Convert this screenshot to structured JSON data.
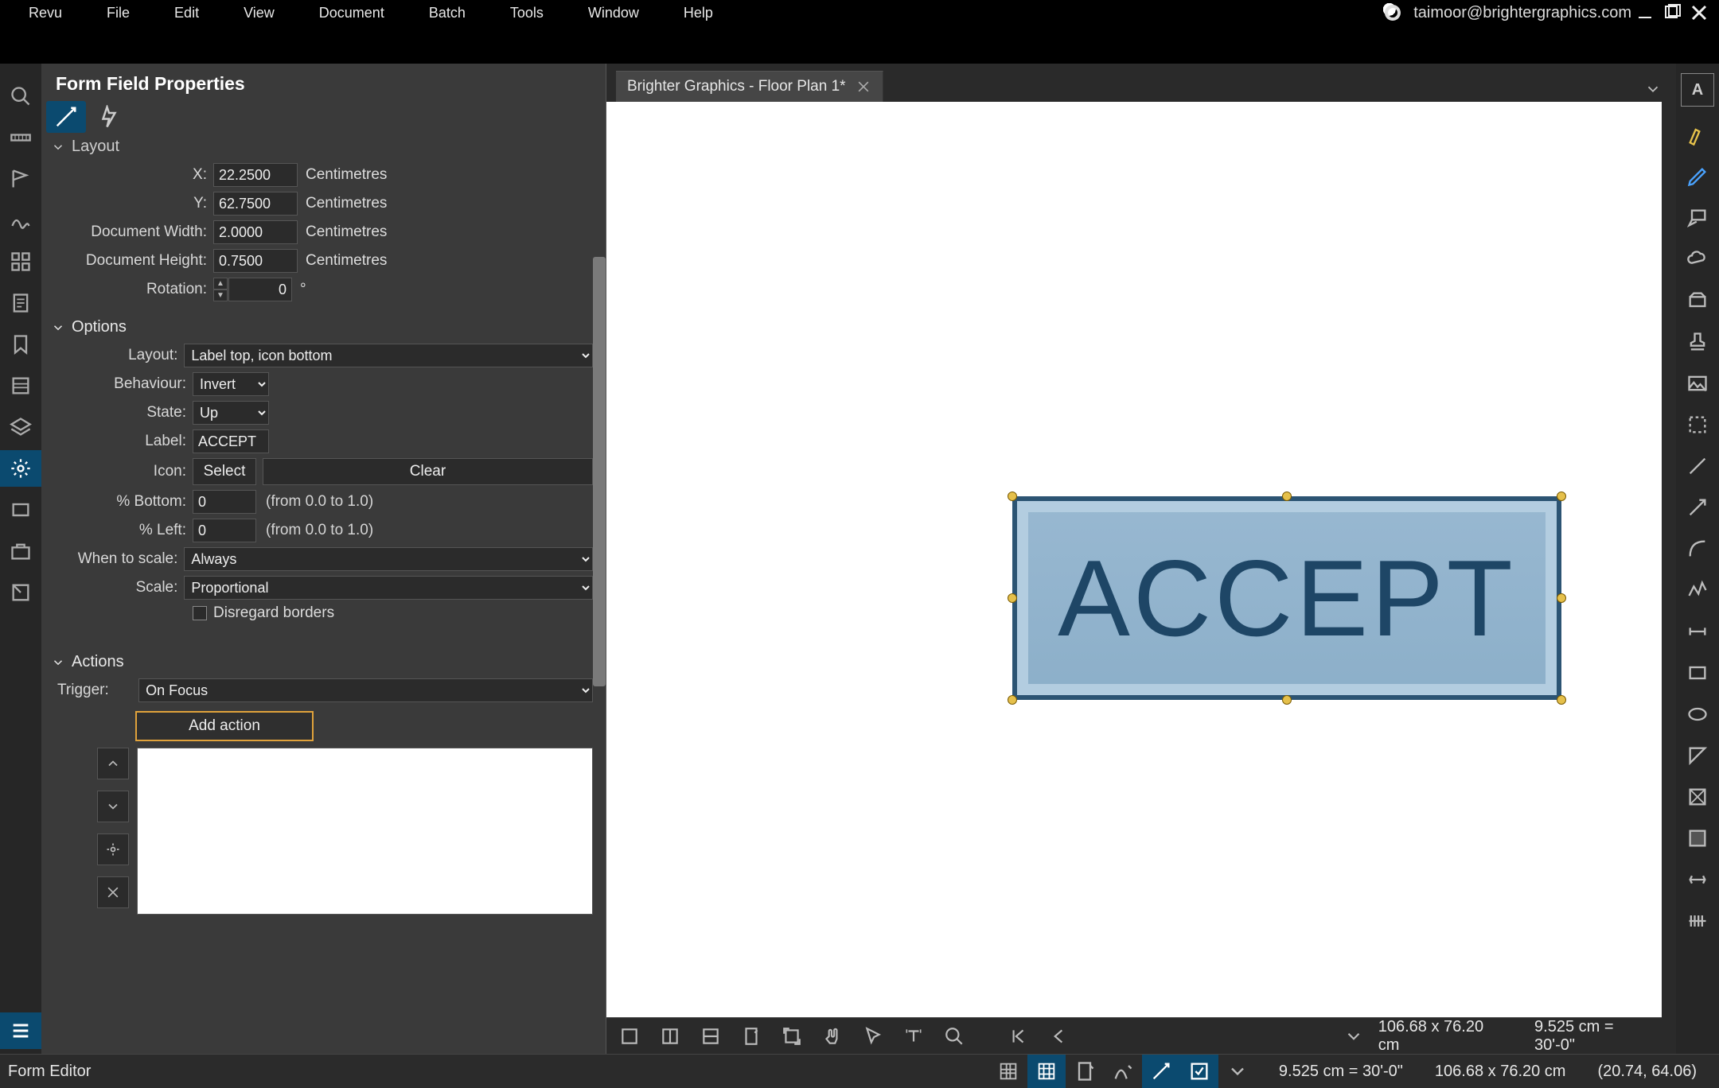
{
  "menu": [
    "Revu",
    "File",
    "Edit",
    "View",
    "Document",
    "Batch",
    "Tools",
    "Window",
    "Help"
  ],
  "user_email": "taimoor@brightergraphics.com",
  "panel_title": "Form Field Properties",
  "sections": {
    "layout": "Layout",
    "options": "Options",
    "actions": "Actions"
  },
  "layout": {
    "x_lbl": "X:",
    "x": "22.2500",
    "y_lbl": "Y:",
    "y": "62.7500",
    "dw_lbl": "Document Width:",
    "dw": "2.0000",
    "dh_lbl": "Document Height:",
    "dh": "0.7500",
    "rot_lbl": "Rotation:",
    "rot": "0",
    "unit": "Centimetres",
    "deg": "°"
  },
  "options": {
    "layout_lbl": "Layout:",
    "layout_val": "Label top, icon bottom",
    "behaviour_lbl": "Behaviour:",
    "behaviour_val": "Invert",
    "state_lbl": "State:",
    "state_val": "Up",
    "label_lbl": "Label:",
    "label_val": "ACCEPT",
    "icon_lbl": "Icon:",
    "select_btn": "Select",
    "clear_btn": "Clear",
    "pct_bottom_lbl": "% Bottom:",
    "pct_bottom_val": "0",
    "pct_left_lbl": "% Left:",
    "pct_left_val": "0",
    "range_hint": "(from 0.0 to 1.0)",
    "when_lbl": "When to scale:",
    "when_val": "Always",
    "scale_lbl": "Scale:",
    "scale_val": "Proportional",
    "disregard": "Disregard borders"
  },
  "actions": {
    "trigger_lbl": "Trigger:",
    "trigger_val": "On Focus",
    "add_action": "Add action"
  },
  "document_tab": "Brighter Graphics - Floor Plan 1*",
  "button_text": "ACCEPT",
  "canvas_status": {
    "size": "106.68 x 76.20 cm",
    "scale": "9.525 cm = 30'-0\""
  },
  "statusbar": {
    "mode": "Form Editor",
    "scale": "9.525 cm = 30'-0\"",
    "size": "106.68 x 76.20 cm",
    "coords": "(20.74, 64.06)"
  }
}
